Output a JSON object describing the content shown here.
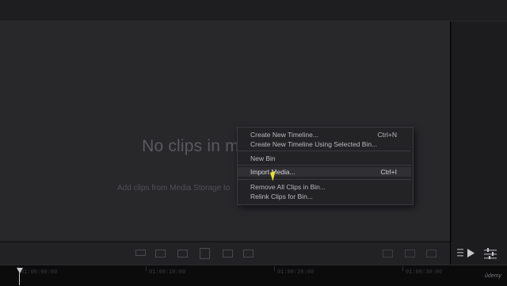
{
  "media_pool": {
    "empty_title": "No clips in media pool",
    "empty_subtitle": "Add clips from Media Storage to"
  },
  "context_menu": {
    "items": [
      {
        "label": "Create New Timeline...",
        "shortcut": "Ctrl+N"
      },
      {
        "label": "Create New Timeline Using Selected Bin...",
        "shortcut": ""
      },
      {
        "label": "New Bin",
        "shortcut": ""
      },
      {
        "label": "Import Media...",
        "shortcut": "Ctrl+I",
        "highlighted": true
      },
      {
        "label": "Remove All Clips in Bin...",
        "shortcut": ""
      },
      {
        "label": "Relink Clips for Bin...",
        "shortcut": ""
      }
    ]
  },
  "timeline": {
    "timecodes": [
      "01:00:00:00",
      "01:00:10:00",
      "01:00:20:00",
      "01:00:30:00"
    ]
  },
  "toolbar": {
    "icons": [
      "clip-view-icon",
      "append-icon",
      "overwrite-icon",
      "replace-icon",
      "place-on-top-icon",
      "ripple-icon"
    ],
    "right_icons": [
      "list-view-icon",
      "thumbnail-view-icon",
      "waveform-icon",
      "play-panel-icon",
      "settings-sliders-icon"
    ]
  },
  "watermark": "ûdemy"
}
